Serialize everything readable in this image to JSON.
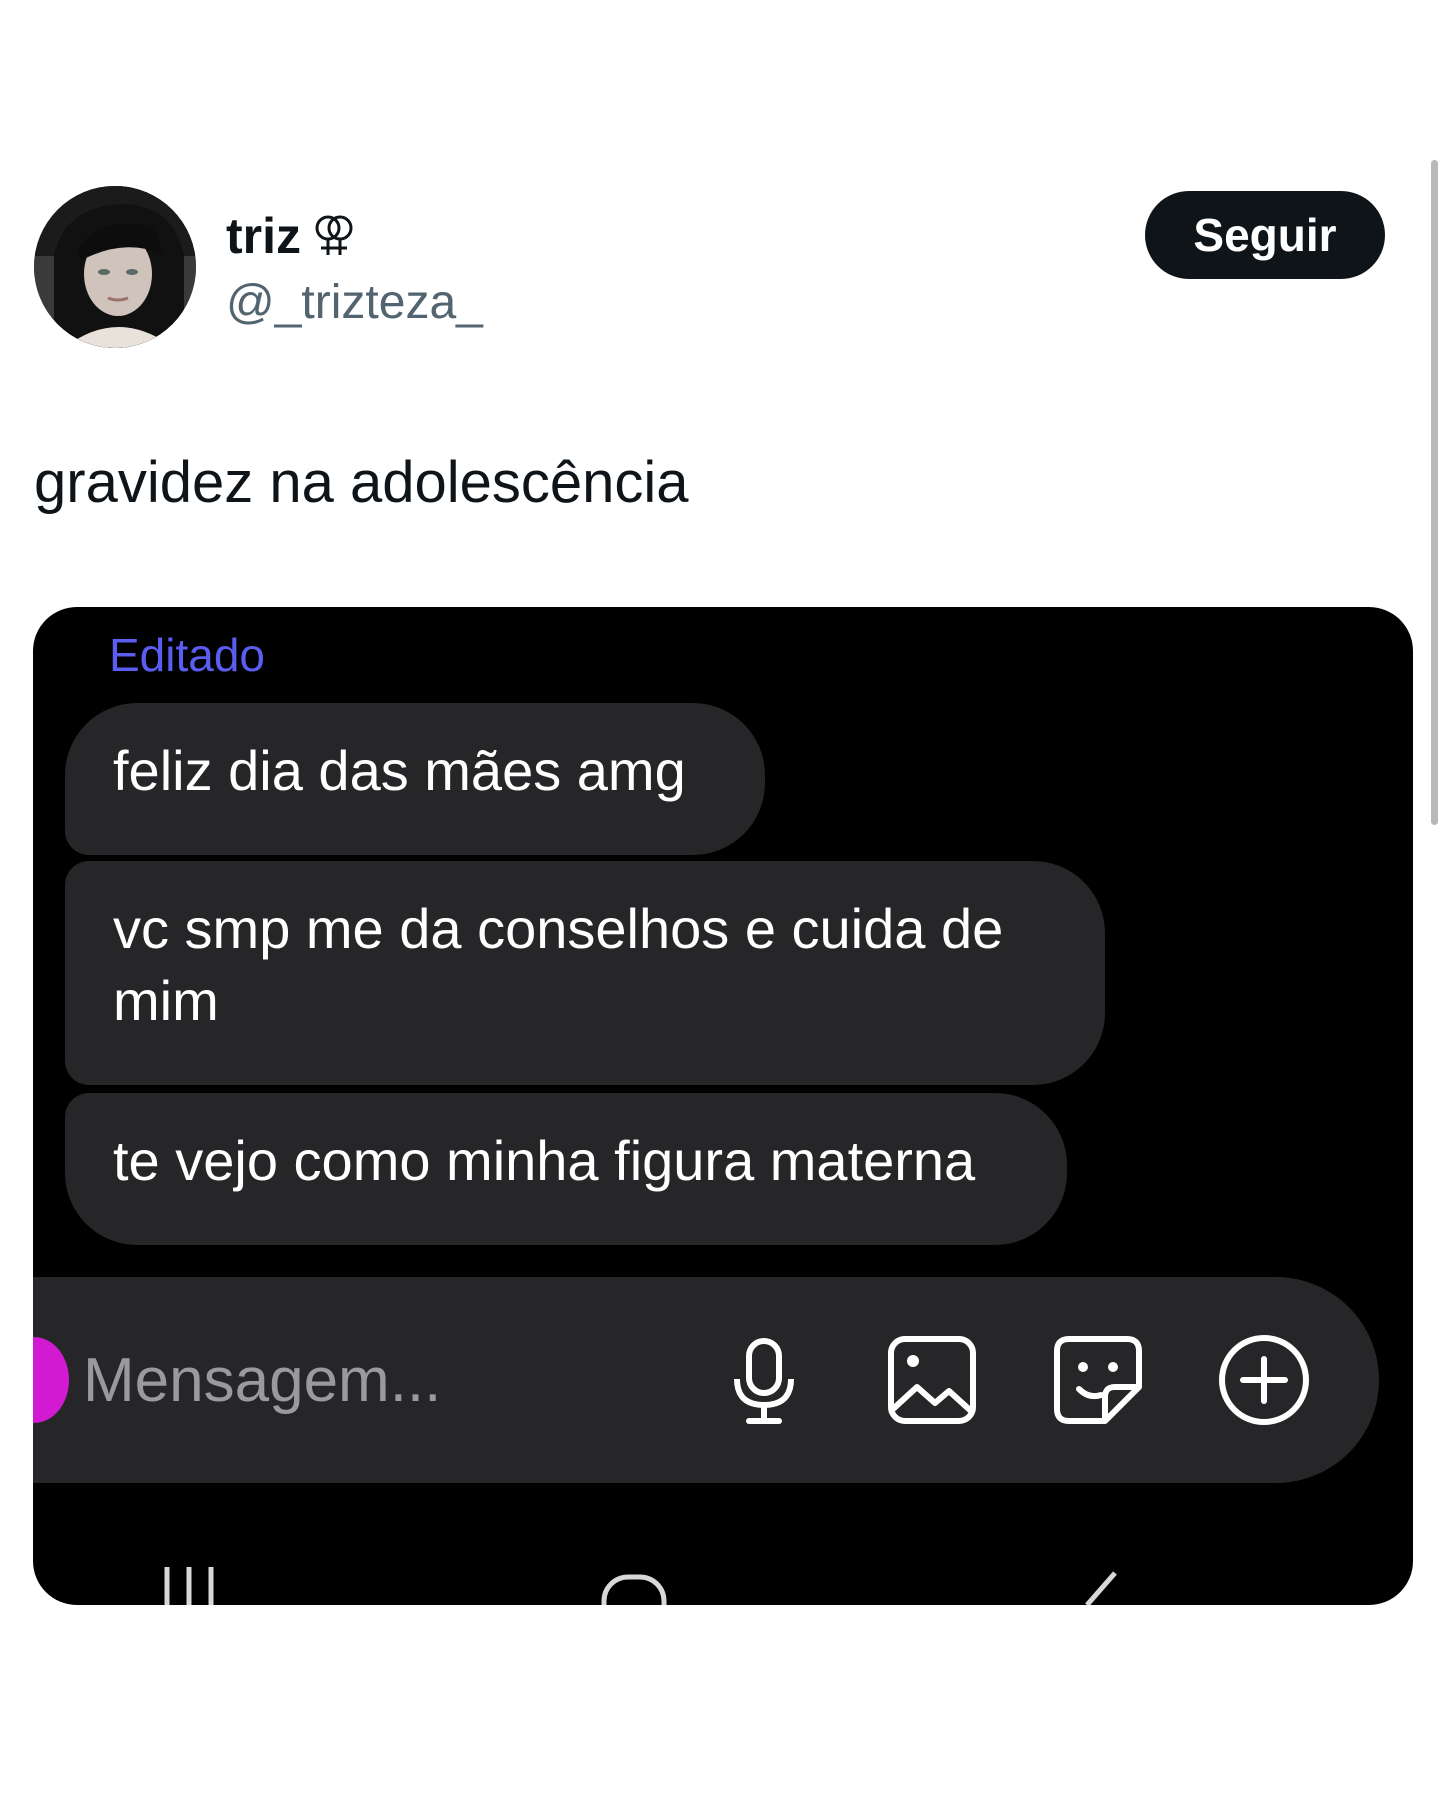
{
  "tweet": {
    "display_name": "triz",
    "handle": "@_trizteza_",
    "follow_label": "Seguir",
    "text": "gravidez na adolescência"
  },
  "chat": {
    "edited_label": "Editado",
    "messages": [
      {
        "lines": [
          "feliz dia das mães amg"
        ]
      },
      {
        "lines": [
          "vc smp me da conselhos e cuida de",
          "mim"
        ]
      },
      {
        "lines": [
          "te vejo como minha figura materna"
        ]
      }
    ],
    "composer": {
      "placeholder": "Mensagem...",
      "icons": [
        "mic-icon",
        "image-icon",
        "sticker-icon",
        "plus-circle-icon"
      ]
    },
    "nav_icons": [
      "recent-apps-icon",
      "home-icon",
      "back-icon"
    ]
  },
  "colors": {
    "accent_edited": "#5b5cf0",
    "bubble": "#262628",
    "follow_button": "#0f1419",
    "composer_edge": "#d21ad2"
  }
}
